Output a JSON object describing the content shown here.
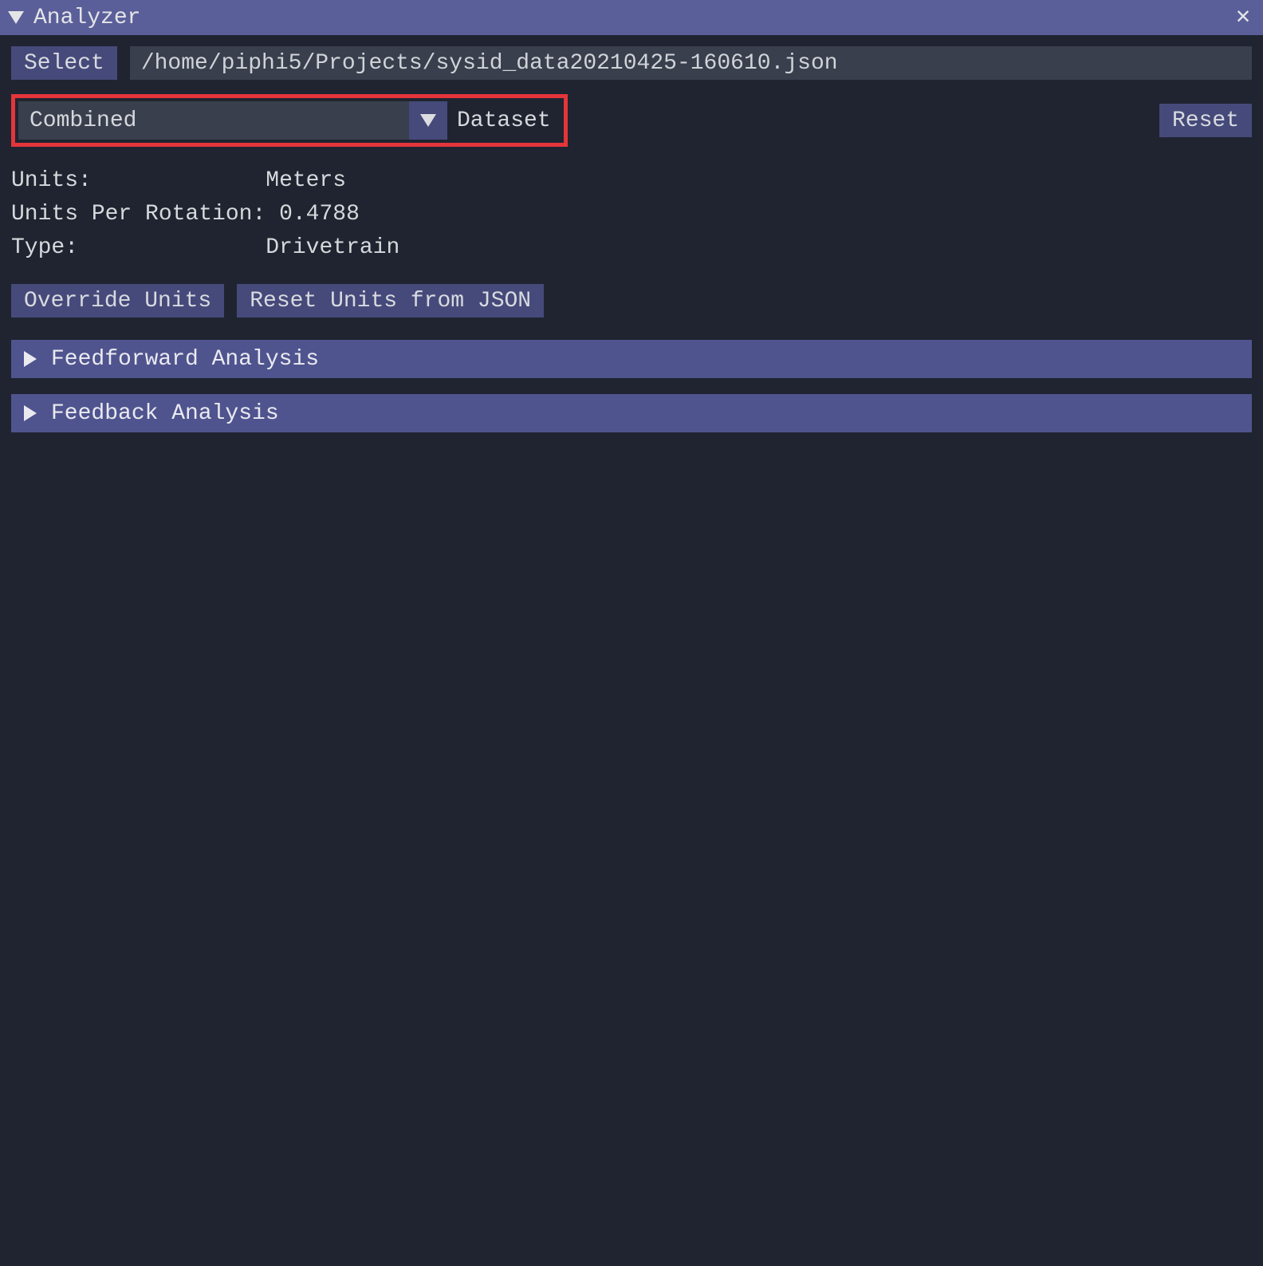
{
  "titlebar": {
    "title": "Analyzer"
  },
  "toolbar": {
    "select_label": "Select",
    "path": "/home/piphi5/Projects/sysid_data20210425-160610.json"
  },
  "dataset": {
    "value": "Combined",
    "label": "Dataset",
    "reset_label": "Reset"
  },
  "info": {
    "units_label": "Units:             ",
    "units_value": "Meters",
    "upr_label": "Units Per Rotation: ",
    "upr_value": "0.4788",
    "type_label": "Type:              ",
    "type_value": "Drivetrain"
  },
  "buttons": {
    "override_units": "Override Units",
    "reset_units": "Reset Units from JSON"
  },
  "sections": {
    "feedforward": "Feedforward Analysis",
    "feedback": "Feedback Analysis"
  }
}
